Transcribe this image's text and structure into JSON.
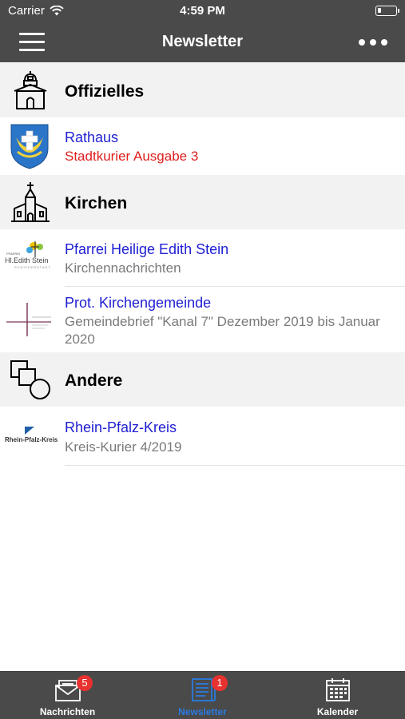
{
  "status_bar": {
    "carrier": "Carrier",
    "time": "4:59 PM"
  },
  "header": {
    "title": "Newsletter"
  },
  "sections": [
    {
      "title": "Offizielles",
      "icon": "town-hall-icon",
      "items": [
        {
          "name": "Rathaus",
          "subtitle": "Stadtkurier Ausgabe 3",
          "subtitle_color": "#e01e1e",
          "logo": "coat-of-arms"
        }
      ]
    },
    {
      "title": "Kirchen",
      "icon": "church-icon",
      "items": [
        {
          "name": "Pfarrei Heilige Edith Stein",
          "subtitle": "Kirchennachrichten",
          "logo": "edith-stein-logo",
          "logo_small": "PFARREI",
          "logo_text": "Hl.Edith Stein",
          "logo_sub": "SCHIFFERSTADT"
        },
        {
          "name": "Prot. Kirchengemeinde",
          "subtitle": "Gemeindebrief \"Kanal 7\" Dezember 2019 bis Januar 2020",
          "logo": "prot-kirche-logo"
        }
      ]
    },
    {
      "title": "Andere",
      "icon": "shapes-icon",
      "items": [
        {
          "name": "Rhein-Pfalz-Kreis",
          "subtitle": "Kreis-Kurier 4/2019",
          "logo": "rhein-pfalz-kreis-logo",
          "logo_text": "Rhein-Pfalz-Kreis"
        }
      ]
    }
  ],
  "tabbar": {
    "tabs": [
      {
        "label": "Nachrichten",
        "icon": "envelope-icon",
        "badge": "5",
        "active": false
      },
      {
        "label": "Newsletter",
        "icon": "newspaper-icon",
        "badge": "1",
        "active": true
      },
      {
        "label": "Kalender",
        "icon": "calendar-icon",
        "badge": "",
        "active": false
      }
    ]
  },
  "colors": {
    "bar": "#4a4a4a",
    "link": "#1e1ed2",
    "accent": "#2a7be0",
    "badge": "#e8322f",
    "section_bg": "#f2f2f2"
  }
}
